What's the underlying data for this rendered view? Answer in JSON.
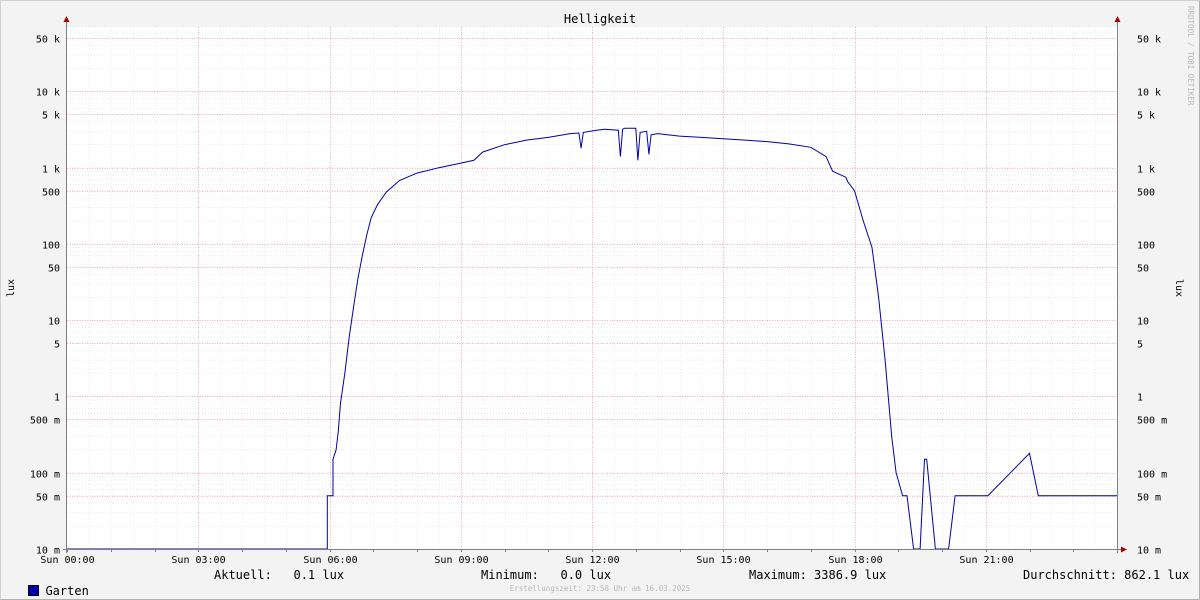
{
  "chart_data": {
    "type": "line",
    "title": "Helligkeit",
    "ylabel": "lux",
    "ylabel_right": "lux",
    "yscale": "log",
    "ylim": [
      0.01,
      70000
    ],
    "xlim": [
      "00:00",
      "24:00"
    ],
    "x_ticks": [
      "Sun 00:00",
      "Sun 03:00",
      "Sun 06:00",
      "Sun 09:00",
      "Sun 12:00",
      "Sun 15:00",
      "Sun 18:00",
      "Sun 21:00"
    ],
    "x_tick_hours": [
      0,
      3,
      6,
      9,
      12,
      15,
      18,
      21
    ],
    "y_ticks": [
      {
        "value": 0.01,
        "label": "10 m"
      },
      {
        "value": 0.05,
        "label": "50 m"
      },
      {
        "value": 0.1,
        "label": "100 m"
      },
      {
        "value": 0.5,
        "label": "500 m"
      },
      {
        "value": 1,
        "label": "1"
      },
      {
        "value": 5,
        "label": "5"
      },
      {
        "value": 10,
        "label": "10"
      },
      {
        "value": 50,
        "label": "50"
      },
      {
        "value": 100,
        "label": "100"
      },
      {
        "value": 500,
        "label": "500"
      },
      {
        "value": 1000,
        "label": "1 k"
      },
      {
        "value": 5000,
        "label": "5 k"
      },
      {
        "value": 10000,
        "label": "10 k"
      },
      {
        "value": 50000,
        "label": "50 k"
      }
    ],
    "grid": true,
    "series": [
      {
        "name": "Garten",
        "color": "#0000aa",
        "hours": [
          0,
          5.95,
          5.95,
          6.08,
          6.08,
          6.15,
          6.2,
          6.25,
          6.35,
          6.45,
          6.55,
          6.65,
          6.75,
          6.85,
          6.95,
          7.1,
          7.3,
          7.6,
          8.0,
          8.5,
          9.0,
          9.3,
          9.5,
          10.0,
          10.5,
          11.0,
          11.5,
          11.7,
          11.75,
          11.8,
          12.1,
          12.3,
          12.6,
          12.65,
          12.7,
          12.75,
          13.0,
          13.05,
          13.1,
          13.25,
          13.3,
          13.35,
          13.5,
          14.0,
          14.5,
          15.0,
          15.5,
          16.0,
          16.5,
          17.0,
          17.35,
          17.5,
          17.8,
          17.85,
          18.0,
          18.2,
          18.4,
          18.55,
          18.7,
          18.85,
          18.95,
          19.1,
          19.2,
          19.35,
          19.5,
          19.6,
          19.65,
          19.85,
          19.85,
          20.0,
          20.0,
          20.15,
          20.15,
          20.3,
          20.3,
          21.05,
          21.05,
          22.0,
          22.0,
          22.2,
          22.2,
          24.0
        ],
        "values": [
          0.01,
          0.01,
          0.05,
          0.05,
          0.15,
          0.2,
          0.35,
          0.8,
          2,
          6,
          15,
          35,
          70,
          130,
          220,
          330,
          480,
          680,
          850,
          1000,
          1150,
          1250,
          1600,
          2000,
          2300,
          2500,
          2800,
          2850,
          1800,
          2900,
          3100,
          3200,
          3100,
          1400,
          3200,
          3300,
          3300,
          1250,
          2900,
          3000,
          1500,
          2700,
          2800,
          2600,
          2500,
          2400,
          2300,
          2200,
          2050,
          1850,
          1400,
          900,
          750,
          650,
          500,
          200,
          90,
          20,
          3,
          0.3,
          0.1,
          0.05,
          0.05,
          0.01,
          0.01,
          0.15,
          0.15,
          0.01,
          0.01,
          0.01,
          0.01,
          0.01,
          0.01,
          0.05,
          0.05,
          0.05,
          0.05,
          0.18,
          0.18,
          0.05,
          0.05,
          0.05
        ]
      }
    ]
  },
  "legend": {
    "series_name": "Garten",
    "current": "Aktuell:   0.1 lux",
    "minimum": "Minimum:   0.0 lux",
    "maximum": "Maximum: 3386.9 lux",
    "average": "Durchschnitt: 862.1 lux"
  },
  "footer": "Erstellungszeit: 23:58 Uhr am 16.03.2025",
  "watermark": "RRDTOOL / TOBI OETIKER"
}
